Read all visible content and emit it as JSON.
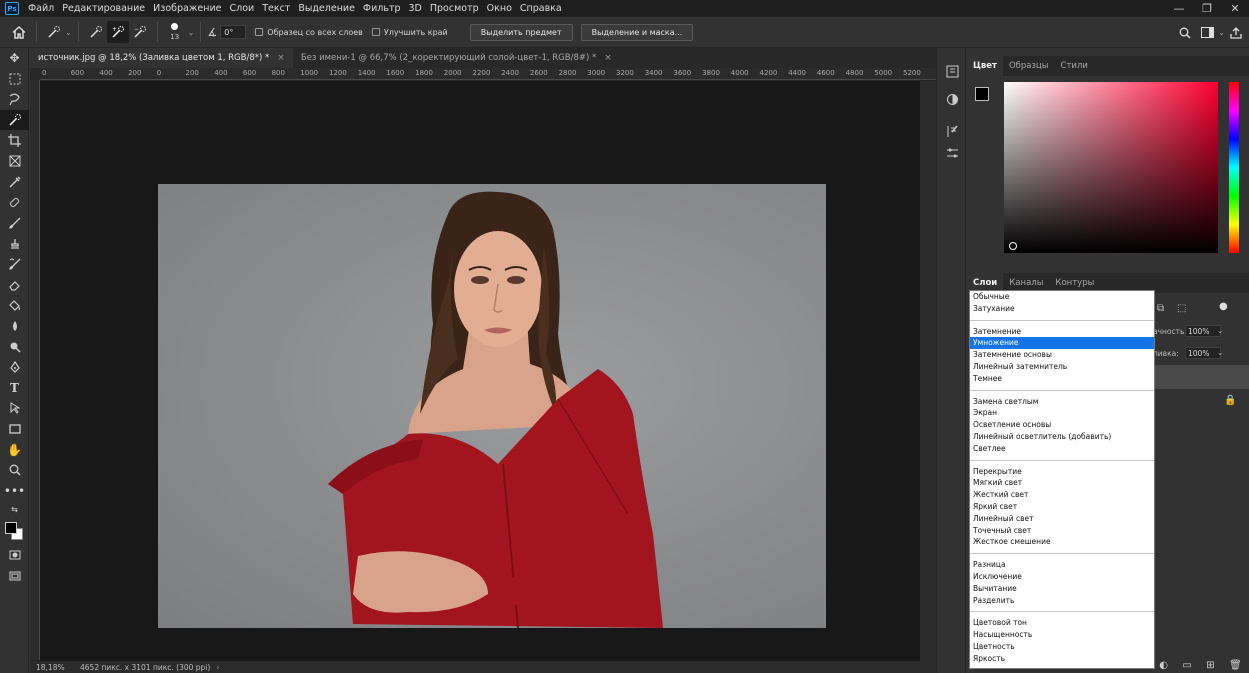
{
  "app": {
    "logo": "Ps"
  },
  "menu": [
    "Файл",
    "Редактирование",
    "Изображение",
    "Слои",
    "Текст",
    "Выделение",
    "Фильтр",
    "3D",
    "Просмотр",
    "Окно",
    "Справка"
  ],
  "window_controls": [
    "—",
    "❐",
    "✕"
  ],
  "options": {
    "brush_size": "13",
    "angle_value": "0°",
    "sample_all_label": "Образец со всех слоев",
    "enhance_edge_label": "Улучшить край",
    "select_subject_label": "Выделить предмет",
    "select_and_mask_label": "Выделение и маска..."
  },
  "tabs": [
    {
      "label": "источник.jpg @ 18,2% (Заливка цветом 1, RGB/8*) *",
      "close": "×"
    },
    {
      "label": "Без имени-1 @ 66,7% (2_коректирующий солой-цвет-1, RGB/8#) *",
      "close": "×"
    }
  ],
  "ruler_ticks": [
    "0",
    "600",
    "400",
    "200",
    "0",
    "200",
    "400",
    "600",
    "800",
    "1000",
    "1200",
    "1400",
    "1600",
    "1800",
    "2000",
    "2200",
    "2400",
    "2600",
    "2800",
    "3000",
    "3200",
    "3400",
    "3600",
    "3800",
    "4000",
    "4200",
    "4400",
    "4600",
    "4800",
    "5000",
    "5200"
  ],
  "status": {
    "zoom": "18,18%",
    "doc_info": "4652 пикс. x 3101 пикс. (300 ppi)"
  },
  "panels": {
    "color_tabs": [
      "Цвет",
      "Образцы",
      "Стили"
    ],
    "layers_tabs": [
      "Слои",
      "Каналы",
      "Контуры"
    ],
    "opacity_label": "ачность:",
    "opacity_value": "100%",
    "fill_label": "ливка:",
    "fill_value": "100%"
  },
  "blend_modes": [
    [
      "Обычные",
      "Затухание"
    ],
    [
      "Затемнение",
      "Умножение",
      "Затемнение основы",
      "Линейный затемнитель",
      "Темнее"
    ],
    [
      "Замена светлым",
      "Экран",
      "Осветление основы",
      "Линейный осветлитель (добавить)",
      "Светлее"
    ],
    [
      "Перекрытие",
      "Мягкий свет",
      "Жесткий свет",
      "Яркий свет",
      "Линейный свет",
      "Точечный свет",
      "Жесткое смешение"
    ],
    [
      "Разница",
      "Исключение",
      "Вычитание",
      "Разделить"
    ],
    [
      "Цветовой тон",
      "Насыщенность",
      "Цветность",
      "Яркость"
    ]
  ],
  "blend_selected": "Умножение",
  "colors": {
    "accent": "#1473e6",
    "garment": "#a2141e",
    "backdrop": "#8e8f91"
  }
}
